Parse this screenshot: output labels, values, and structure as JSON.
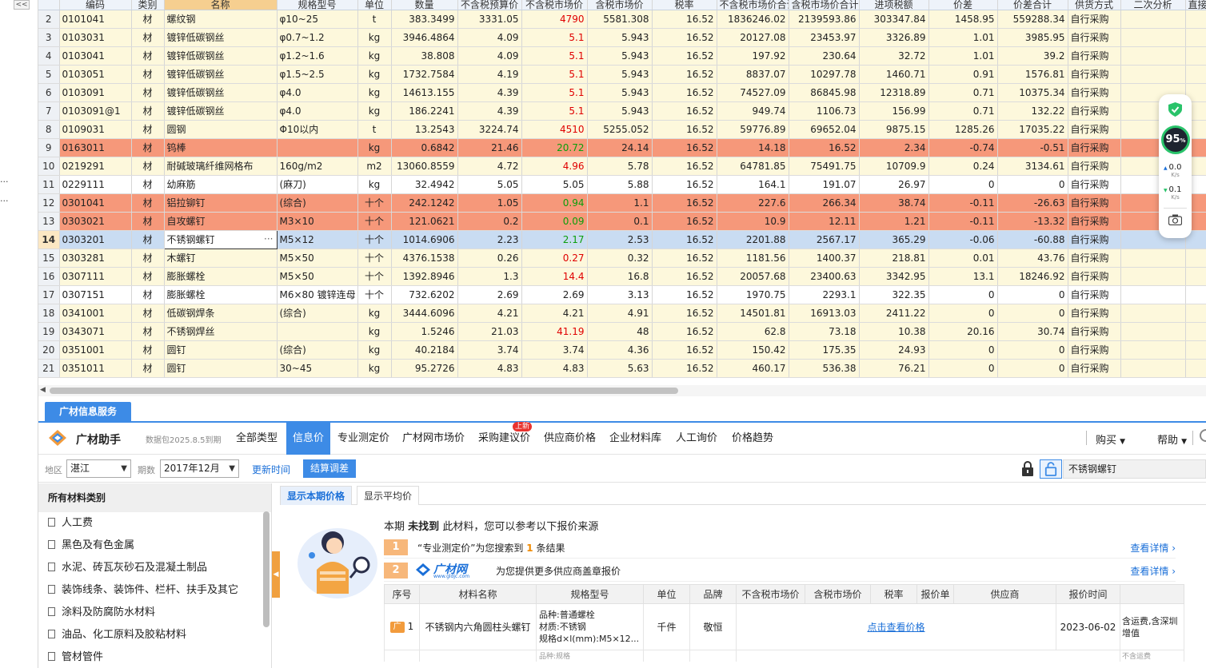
{
  "grid": {
    "columns": [
      "",
      "编码",
      "类别",
      "名称",
      "规格型号",
      "单位",
      "数量",
      "不含税预算价",
      "不含税市场价",
      "含税市场价",
      "税率",
      "不含税市场价合计",
      "含税市场价合计",
      "进项税额",
      "价差",
      "价差合计",
      "供货方式",
      "二次分析",
      "直接"
    ],
    "rows": [
      {
        "n": "2",
        "code": "0101041",
        "cat": "材",
        "name": "螺纹钢",
        "spec": "φ10~25",
        "unit": "t",
        "qty": "383.3499",
        "budget": "3331.05",
        "mkt": "4790",
        "mkt_tax": "5581.308",
        "rate": "16.52",
        "sum_mkt": "1836246.02",
        "sum_mkt_tax": "2139593.86",
        "tax": "303347.84",
        "diff": "1458.95",
        "diff_sum": "559288.34",
        "supply": "自行采购"
      },
      {
        "n": "3",
        "code": "0103031",
        "cat": "材",
        "name": "镀锌低碳钢丝",
        "spec": "φ0.7~1.2",
        "unit": "kg",
        "qty": "3946.4864",
        "budget": "4.09",
        "mkt": "5.1",
        "mkt_tax": "5.943",
        "rate": "16.52",
        "sum_mkt": "20127.08",
        "sum_mkt_tax": "23453.97",
        "tax": "3326.89",
        "diff": "1.01",
        "diff_sum": "3985.95",
        "supply": "自行采购"
      },
      {
        "n": "4",
        "code": "0103041",
        "cat": "材",
        "name": "镀锌低碳钢丝",
        "spec": "φ1.2~1.6",
        "unit": "kg",
        "qty": "38.808",
        "budget": "4.09",
        "mkt": "5.1",
        "mkt_tax": "5.943",
        "rate": "16.52",
        "sum_mkt": "197.92",
        "sum_mkt_tax": "230.64",
        "tax": "32.72",
        "diff": "1.01",
        "diff_sum": "39.2",
        "supply": "自行采购"
      },
      {
        "n": "5",
        "code": "0103051",
        "cat": "材",
        "name": "镀锌低碳钢丝",
        "spec": "φ1.5~2.5",
        "unit": "kg",
        "qty": "1732.7584",
        "budget": "4.19",
        "mkt": "5.1",
        "mkt_tax": "5.943",
        "rate": "16.52",
        "sum_mkt": "8837.07",
        "sum_mkt_tax": "10297.78",
        "tax": "1460.71",
        "diff": "0.91",
        "diff_sum": "1576.81",
        "supply": "自行采购"
      },
      {
        "n": "6",
        "code": "0103091",
        "cat": "材",
        "name": "镀锌低碳钢丝",
        "spec": "φ4.0",
        "unit": "kg",
        "qty": "14613.155",
        "budget": "4.39",
        "mkt": "5.1",
        "mkt_tax": "5.943",
        "rate": "16.52",
        "sum_mkt": "74527.09",
        "sum_mkt_tax": "86845.98",
        "tax": "12318.89",
        "diff": "0.71",
        "diff_sum": "10375.34",
        "supply": "自行采购"
      },
      {
        "n": "7",
        "code": "0103091@1",
        "cat": "材",
        "name": "镀锌低碳钢丝",
        "spec": "φ4.0",
        "unit": "kg",
        "qty": "186.2241",
        "budget": "4.39",
        "mkt": "5.1",
        "mkt_tax": "5.943",
        "rate": "16.52",
        "sum_mkt": "949.74",
        "sum_mkt_tax": "1106.73",
        "tax": "156.99",
        "diff": "0.71",
        "diff_sum": "132.22",
        "supply": "自行采购"
      },
      {
        "n": "8",
        "code": "0109031",
        "cat": "材",
        "name": "圆钢",
        "spec": "Φ10以内",
        "unit": "t",
        "qty": "13.2543",
        "budget": "3224.74",
        "mkt": "4510",
        "mkt_tax": "5255.052",
        "rate": "16.52",
        "sum_mkt": "59776.89",
        "sum_mkt_tax": "69652.04",
        "tax": "9875.15",
        "diff": "1285.26",
        "diff_sum": "17035.22",
        "supply": "自行采购"
      },
      {
        "n": "9",
        "code": "0163011",
        "cat": "材",
        "name": "钨棒",
        "spec": "",
        "unit": "kg",
        "qty": "0.6842",
        "budget": "21.46",
        "mkt": "20.72",
        "mkt_tax": "24.14",
        "rate": "16.52",
        "sum_mkt": "14.18",
        "sum_mkt_tax": "16.52",
        "tax": "2.34",
        "diff": "-0.74",
        "diff_sum": "-0.51",
        "supply": "自行采购"
      },
      {
        "n": "10",
        "code": "0219291",
        "cat": "材",
        "name": "耐碱玻璃纤维网格布",
        "spec": "160g/m2",
        "unit": "m2",
        "qty": "13060.8559",
        "budget": "4.72",
        "mkt": "4.96",
        "mkt_tax": "5.78",
        "rate": "16.52",
        "sum_mkt": "64781.85",
        "sum_mkt_tax": "75491.75",
        "tax": "10709.9",
        "diff": "0.24",
        "diff_sum": "3134.61",
        "supply": "自行采购"
      },
      {
        "n": "11",
        "code": "0229111",
        "cat": "材",
        "name": "幼麻筋",
        "spec": "(麻刀)",
        "unit": "kg",
        "qty": "32.4942",
        "budget": "5.05",
        "mkt": "5.05",
        "mkt_tax": "5.88",
        "rate": "16.52",
        "sum_mkt": "164.1",
        "sum_mkt_tax": "191.07",
        "tax": "26.97",
        "diff": "0",
        "diff_sum": "0",
        "supply": "自行采购"
      },
      {
        "n": "12",
        "code": "0301041",
        "cat": "材",
        "name": "铝拉铆钉",
        "spec": "(综合)",
        "unit": "十个",
        "qty": "242.1242",
        "budget": "1.05",
        "mkt": "0.94",
        "mkt_tax": "1.1",
        "rate": "16.52",
        "sum_mkt": "227.6",
        "sum_mkt_tax": "266.34",
        "tax": "38.74",
        "diff": "-0.11",
        "diff_sum": "-26.63",
        "supply": "自行采购"
      },
      {
        "n": "13",
        "code": "0303021",
        "cat": "材",
        "name": "自攻螺钉",
        "spec": "M3×10",
        "unit": "十个",
        "qty": "121.0621",
        "budget": "0.2",
        "mkt": "0.09",
        "mkt_tax": "0.1",
        "rate": "16.52",
        "sum_mkt": "10.9",
        "sum_mkt_tax": "12.11",
        "tax": "1.21",
        "diff": "-0.11",
        "diff_sum": "-13.32",
        "supply": "自行采购"
      },
      {
        "n": "14",
        "code": "0303201",
        "cat": "材",
        "name": "不锈钢螺钉",
        "spec": "M5×12",
        "unit": "十个",
        "qty": "1014.6906",
        "budget": "2.23",
        "mkt": "2.17",
        "mkt_tax": "2.53",
        "rate": "16.52",
        "sum_mkt": "2201.88",
        "sum_mkt_tax": "2567.17",
        "tax": "365.29",
        "diff": "-0.06",
        "diff_sum": "-60.88",
        "supply": "自行采购"
      },
      {
        "n": "15",
        "code": "0303281",
        "cat": "材",
        "name": "木螺钉",
        "spec": "M5×50",
        "unit": "十个",
        "qty": "4376.1538",
        "budget": "0.26",
        "mkt": "0.27",
        "mkt_tax": "0.32",
        "rate": "16.52",
        "sum_mkt": "1181.56",
        "sum_mkt_tax": "1400.37",
        "tax": "218.81",
        "diff": "0.01",
        "diff_sum": "43.76",
        "supply": "自行采购"
      },
      {
        "n": "16",
        "code": "0307111",
        "cat": "材",
        "name": "膨胀螺栓",
        "spec": "M5×50",
        "unit": "十个",
        "qty": "1392.8946",
        "budget": "1.3",
        "mkt": "14.4",
        "mkt_tax": "16.8",
        "rate": "16.52",
        "sum_mkt": "20057.68",
        "sum_mkt_tax": "23400.63",
        "tax": "3342.95",
        "diff": "13.1",
        "diff_sum": "18246.92",
        "supply": "自行采购"
      },
      {
        "n": "17",
        "code": "0307151",
        "cat": "材",
        "name": "膨胀螺栓",
        "spec": "M6×80 镀锌连母",
        "unit": "十个",
        "qty": "732.6202",
        "budget": "2.69",
        "mkt": "2.69",
        "mkt_tax": "3.13",
        "rate": "16.52",
        "sum_mkt": "1970.75",
        "sum_mkt_tax": "2293.1",
        "tax": "322.35",
        "diff": "0",
        "diff_sum": "0",
        "supply": "自行采购"
      },
      {
        "n": "18",
        "code": "0341001",
        "cat": "材",
        "name": "低碳钢焊条",
        "spec": "(综合)",
        "unit": "kg",
        "qty": "3444.6096",
        "budget": "4.21",
        "mkt": "4.21",
        "mkt_tax": "4.91",
        "rate": "16.52",
        "sum_mkt": "14501.81",
        "sum_mkt_tax": "16913.03",
        "tax": "2411.22",
        "diff": "0",
        "diff_sum": "0",
        "supply": "自行采购"
      },
      {
        "n": "19",
        "code": "0343071",
        "cat": "材",
        "name": "不锈钢焊丝",
        "spec": "",
        "unit": "kg",
        "qty": "1.5246",
        "budget": "21.03",
        "mkt": "41.19",
        "mkt_tax": "48",
        "rate": "16.52",
        "sum_mkt": "62.8",
        "sum_mkt_tax": "73.18",
        "tax": "10.38",
        "diff": "20.16",
        "diff_sum": "30.74",
        "supply": "自行采购"
      },
      {
        "n": "20",
        "code": "0351001",
        "cat": "材",
        "name": "圆钉",
        "spec": "(综合)",
        "unit": "kg",
        "qty": "40.2184",
        "budget": "3.74",
        "mkt": "3.74",
        "mkt_tax": "4.36",
        "rate": "16.52",
        "sum_mkt": "150.42",
        "sum_mkt_tax": "175.35",
        "tax": "24.93",
        "diff": "0",
        "diff_sum": "0",
        "supply": "自行采购"
      },
      {
        "n": "21",
        "code": "0351011",
        "cat": "材",
        "name": "圆钉",
        "spec": "30~45",
        "unit": "kg",
        "qty": "95.2726",
        "budget": "4.83",
        "mkt": "4.83",
        "mkt_tax": "5.63",
        "rate": "16.52",
        "sum_mkt": "460.17",
        "sum_mkt_tax": "536.38",
        "tax": "76.21",
        "diff": "0",
        "diff_sum": "0",
        "supply": "自行采购"
      }
    ],
    "row_styles": [
      "normal",
      "normal",
      "normal",
      "normal",
      "normal",
      "normal",
      "normal",
      "orange",
      "normal",
      "white",
      "orange",
      "orange",
      "selected",
      "normal",
      "normal",
      "white",
      "normal",
      "normal",
      "normal",
      "normal"
    ],
    "mkt_styles": [
      "red",
      "red",
      "red",
      "red",
      "red",
      "red",
      "red",
      "grn",
      "red",
      "",
      "grn",
      "grn",
      "grn",
      "red",
      "red",
      "",
      "",
      "red",
      "",
      ""
    ],
    "selected_row_index": 12
  },
  "left_strip": {
    "collapse_label": "<<",
    "dots": [
      "...",
      "..."
    ]
  },
  "panel": {
    "tab_label": "广材信息服务",
    "brand": "广材助手",
    "db_info": "数据包2025.8.5到期",
    "nav": [
      "全部类型",
      "信息价",
      "专业测定价",
      "广材网市场价",
      "采购建议价",
      "供应商价格",
      "企业材料库",
      "人工询价",
      "价格趋势"
    ],
    "nav_active": "信息价",
    "new_badge": "上新",
    "buy_label": "购买",
    "help_label": "帮助"
  },
  "filter": {
    "region_label": "地区",
    "region_value": "湛江",
    "period_label": "期数",
    "period_value": "2017年12月",
    "update_time": "更新时间",
    "settle_button": "结算调差",
    "search_value": "不锈钢螺钉"
  },
  "categories": {
    "header": "所有材料类别",
    "items": [
      "人工费",
      "黑色及有色金属",
      "水泥、砖瓦灰砂石及混凝土制品",
      "装饰线条、装饰件、栏杆、扶手及其它",
      "涂料及防腐防水材料",
      "油品、化工原料及胶粘材料",
      "管材管件"
    ]
  },
  "content": {
    "subtabs": [
      "显示本期价格",
      "显示平均价"
    ],
    "notfound_pre": "本期",
    "notfound_bold": "未找到",
    "notfound_post": "此材料，您可以参考以下报价来源",
    "result1": {
      "num": "1",
      "pre": "“专业测定价”为您搜索到",
      "count": "1",
      "post": "条结果",
      "link": "查看详情 ›"
    },
    "result2": {
      "num": "2",
      "logo_name": "广材网",
      "logo_url": "www.gldjc.com",
      "text": "为您提供更多供应商盖章报价",
      "link": "查看详情 ›"
    },
    "table_headers": [
      "序号",
      "材料名称",
      "规格型号",
      "单位",
      "品牌",
      "不含税市场价",
      "含税市场价",
      "税率",
      "报价单",
      "供应商",
      "报价时间",
      ""
    ],
    "table_row": {
      "badge": "广",
      "no": "1",
      "name": "不锈钢内六角圆柱头螺钉",
      "spec1": "品种:普通螺栓",
      "spec2": "材质:不锈钢",
      "spec3": "规格d×l(mm):M5×12...",
      "unit": "千件",
      "brand": "敬恒",
      "price_link": "点击查看价格",
      "time": "2023-06-02",
      "note1": "含运费,含深圳",
      "note2": "增值"
    },
    "peek_row": {
      "spec": "品种:规格",
      "note": "不含运费"
    }
  },
  "widget": {
    "percent": "95",
    "percent_unit": "%",
    "up": "0.0",
    "up_unit": "K/s",
    "down": "0.1",
    "down_unit": "K/s"
  }
}
